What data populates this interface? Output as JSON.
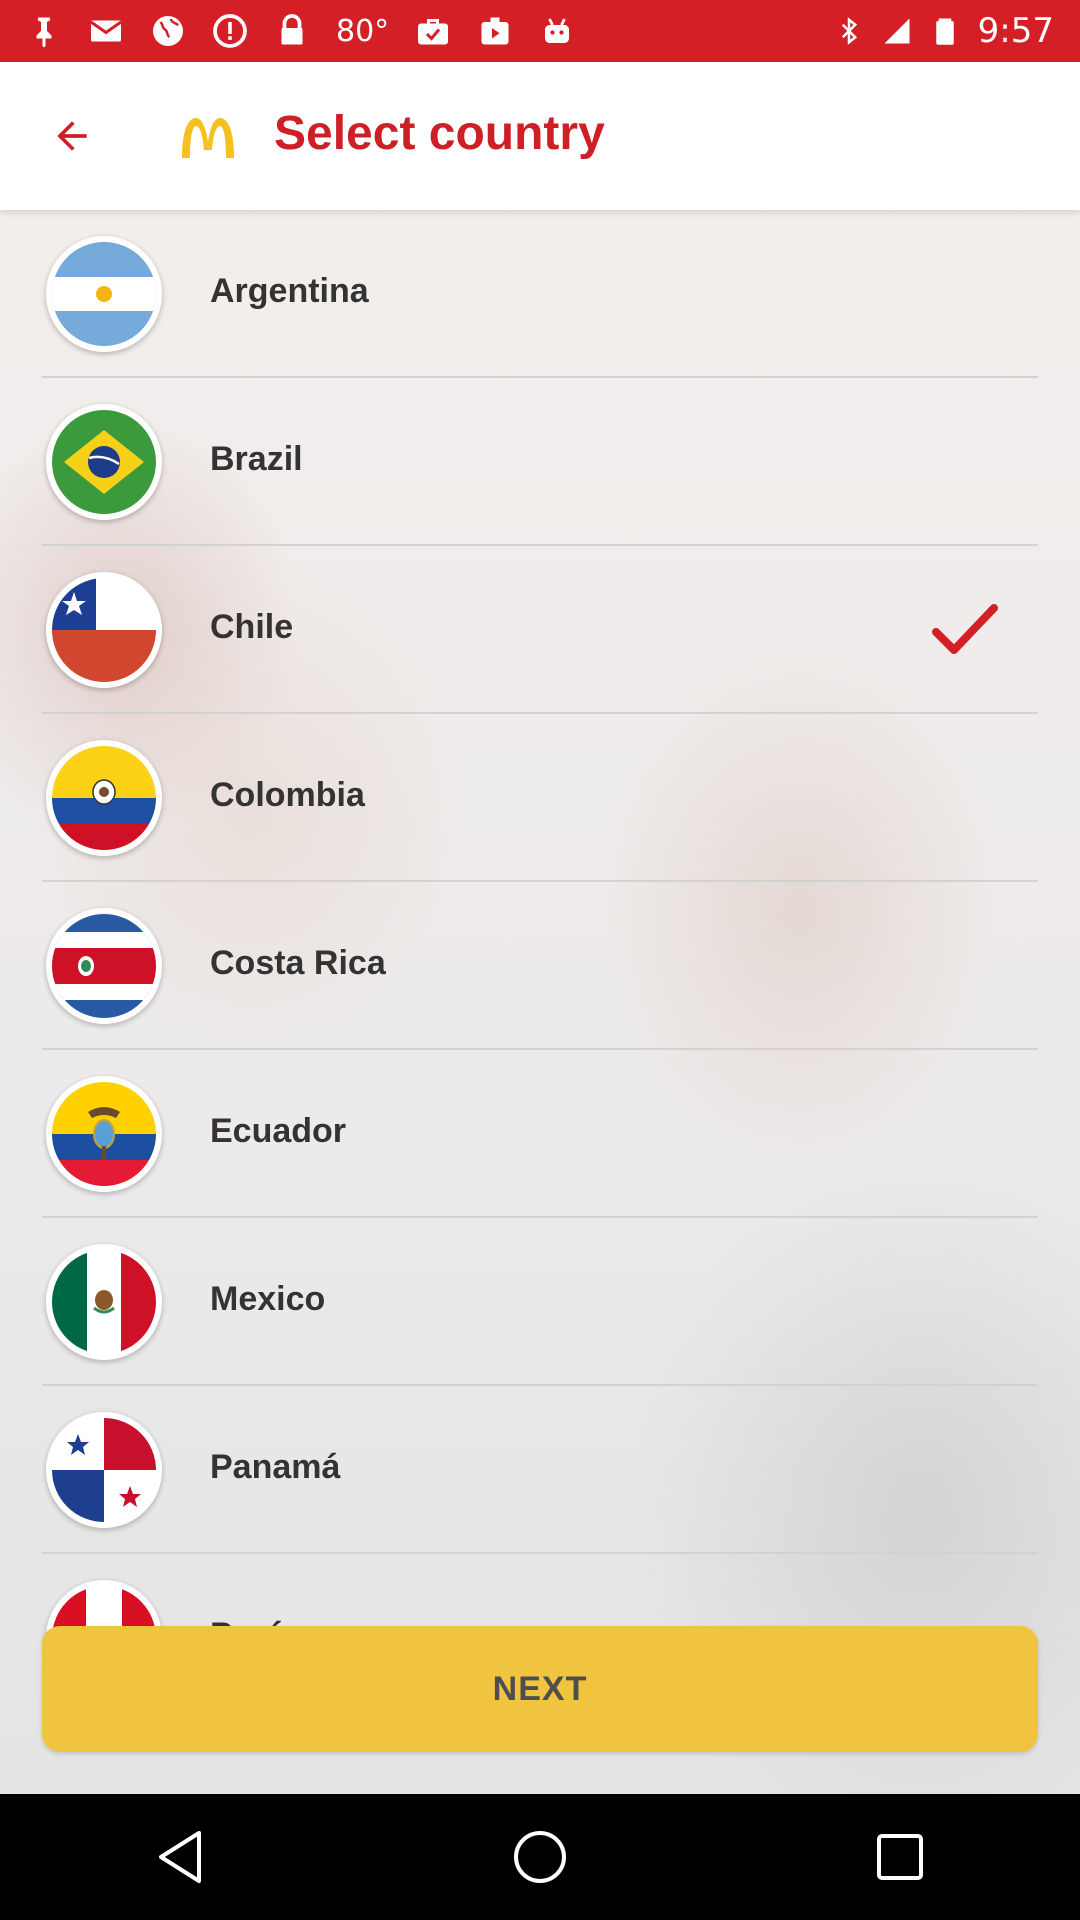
{
  "status_bar": {
    "temperature": "80°",
    "time": "9:57",
    "icons": [
      "pin-icon",
      "mail-icon",
      "globe-icon",
      "alert-icon",
      "lock-icon",
      "briefcase-check-icon",
      "play-store-icon",
      "android-icon",
      "bluetooth-icon",
      "signal-icon",
      "battery-icon"
    ]
  },
  "app_bar": {
    "title": "Select country",
    "logo": "mcdonalds-logo",
    "back_icon": "arrow-left-icon"
  },
  "countries": [
    {
      "name": "Argentina",
      "flag": "argentina-flag",
      "selected": false
    },
    {
      "name": "Brazil",
      "flag": "brazil-flag",
      "selected": false
    },
    {
      "name": "Chile",
      "flag": "chile-flag",
      "selected": true
    },
    {
      "name": "Colombia",
      "flag": "colombia-flag",
      "selected": false
    },
    {
      "name": "Costa Rica",
      "flag": "costa-rica-flag",
      "selected": false
    },
    {
      "name": "Ecuador",
      "flag": "ecuador-flag",
      "selected": false
    },
    {
      "name": "Mexico",
      "flag": "mexico-flag",
      "selected": false
    },
    {
      "name": "Panamá",
      "flag": "panama-flag",
      "selected": false
    },
    {
      "name": "Perú",
      "flag": "peru-flag",
      "selected": false
    }
  ],
  "next_button": {
    "label": "NEXT"
  },
  "colors": {
    "status_bar": "#d41f26",
    "title": "#cf1f26",
    "check": "#d41f26",
    "next_button": "#f0c43e"
  },
  "nav_bar": {
    "icons": [
      "back-triangle-icon",
      "home-circle-icon",
      "recents-square-icon"
    ]
  }
}
